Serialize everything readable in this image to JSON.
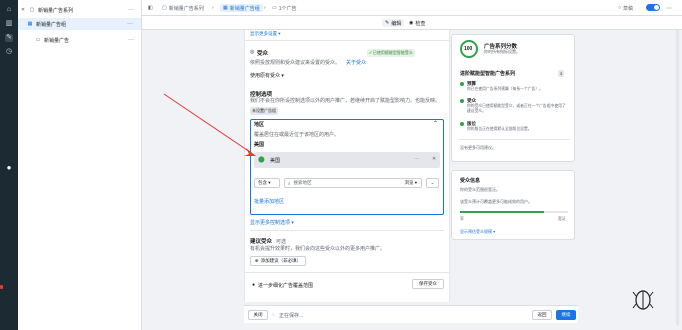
{
  "icons": {
    "tree_close": "close-icon",
    "tree_more": "more-icon",
    "campaign": "campaign-icon",
    "adset": "adset-icon",
    "ad": "ad-icon",
    "grid": "grid-icon",
    "edit": "pencil-icon",
    "eye": "eye-icon",
    "audience": "audience-icon",
    "dial": "gauge-icon",
    "pin": "pin-icon",
    "search": "search-icon",
    "chevron": "chevron-down-icon",
    "gear": "gear-icon",
    "plus": "plus-icon",
    "logo": "brand-logo"
  },
  "colors": {
    "accent": "#1b74e4",
    "success": "#31a24c",
    "arrow": "#e53935",
    "sidebar": "#1c2b33"
  },
  "tree": {
    "campaign": "新销量广告系列",
    "adset": "新销量广告组",
    "ad": "新销量广告"
  },
  "topbar": {
    "crumb_campaign": "新销量广告系列",
    "crumb_adset": "新销量广告组",
    "crumb_ad": "1个广告",
    "status": "草稿"
  },
  "subbar": {
    "edit": "编辑",
    "review": "检查"
  },
  "form": {
    "top_link": "显示更多设置 ▾",
    "audience_title": "受众",
    "audience_badge": "✓ 已使用赋能型智能受众",
    "audience_desc": "依照投放规则和受众建议来设置的受众。",
    "audience_desc_link": "关于受众",
    "audience_dropdown": "使用原有受众 ▾",
    "control_title": "控制选项",
    "control_desc": "我们不会在你所设控制选项以外的用户推广，若继续开启了赋能型影响力。也能反映。",
    "control_chip": "未设置广告组",
    "region_title": "地区",
    "region_desc": "覆盖居住在或最近位于该地区的用户。",
    "region_sub": "美国",
    "country": "美国",
    "include": "包含 ▾",
    "search_placeholder": "搜索地区",
    "browse": "浏览 ▾",
    "batch_add": "批量添加地区",
    "more_options": "显示更多控制选项 ▾",
    "suggest_title": "建议受众",
    "suggest_optional": "可选",
    "suggest_desc": "有机会提升效果时，我们会向这些受众以外的更多用户推广。",
    "add_suggest": "添加建议（非必填）",
    "save_desc": "进一步细化广告覆盖范围",
    "save_audience": "保存受众"
  },
  "panel1": {
    "score": "100",
    "title": "广告系列分数",
    "subtitle": "你的所有指标设置。",
    "section": "进阶赋能型智能广告系列",
    "section_count": "3",
    "items": [
      {
        "title": "预算",
        "desc": "你已在使用广告系列预算（每系一个广告）。"
      },
      {
        "title": "受众",
        "desc": "你的受众已使用赋能型受众，或者正在一个广告组中使用了建议受众。"
      },
      {
        "title": "版位",
        "desc": "你的版位正在使用默认全部版位设置。"
      }
    ],
    "footer": "没有更多可用建议。"
  },
  "panel2": {
    "title": "受众信息",
    "desc": "你的受众范围很宽泛。",
    "note": "该受众预计可覆盖更多可能成效的用户。",
    "label_left": "窄",
    "label_right": "宽泛",
    "level": 0.78,
    "link": "显示预估受众规模 ▾"
  },
  "bottom": {
    "close": "关闭",
    "saving": "正在保存...",
    "back": "返回",
    "next": "继续"
  }
}
